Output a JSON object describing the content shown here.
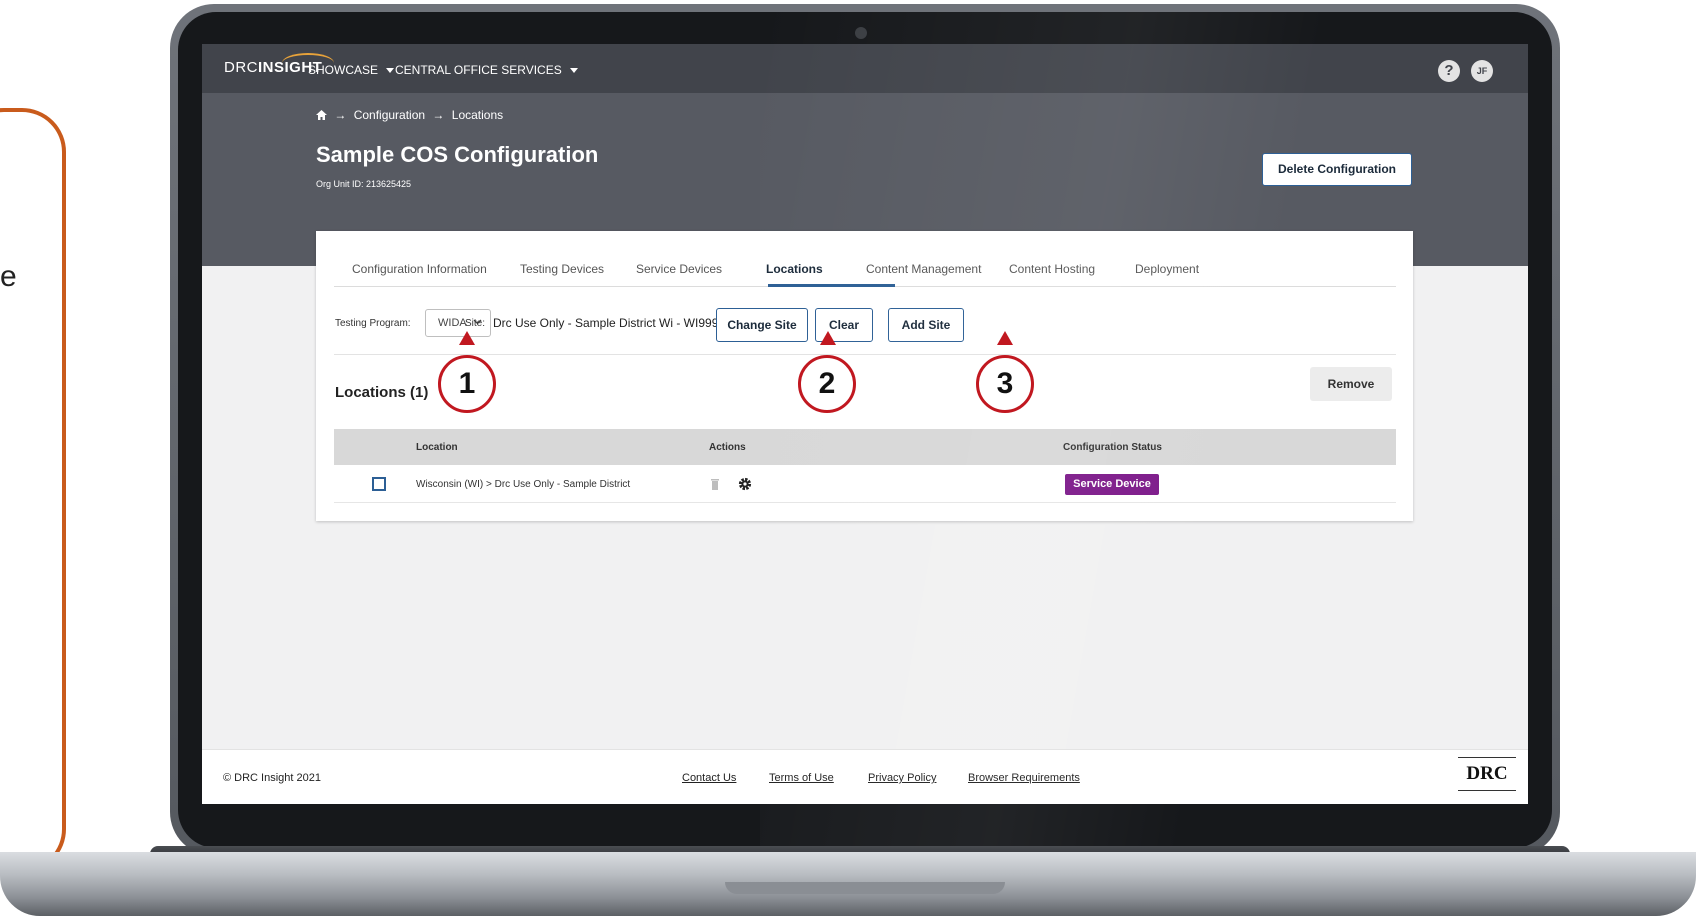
{
  "app": {
    "logo_left": "DRC",
    "logo_right": "INSIGHT",
    "nav": [
      "SHOWCASE",
      "CENTRAL OFFICE SERVICES"
    ],
    "help": "?",
    "avatar": "JF"
  },
  "breadcrumb": {
    "home_icon": "home-icon",
    "items": [
      "Configuration",
      "Locations"
    ],
    "separator": "→"
  },
  "page": {
    "title": "Sample COS Configuration",
    "org_unit": "Org Unit ID: 213625425",
    "delete_label": "Delete Configuration"
  },
  "tabs": [
    {
      "label": "Configuration Information",
      "active": false
    },
    {
      "label": "Testing Devices",
      "active": false
    },
    {
      "label": "Service Devices",
      "active": false
    },
    {
      "label": "Locations",
      "active": true
    },
    {
      "label": "Content Management",
      "active": false
    },
    {
      "label": "Content Hosting",
      "active": false
    },
    {
      "label": "Deployment",
      "active": false
    }
  ],
  "filters": {
    "program_label": "Testing Program:",
    "program_value": "WIDA",
    "site_label": "Site:",
    "site_value": "Drc Use Only - Sample District Wi - WI99999",
    "change_site": "Change Site",
    "clear": "Clear",
    "add_site": "Add Site"
  },
  "locations": {
    "title": "Locations (1)",
    "remove_label": "Remove",
    "columns": [
      "Location",
      "Actions",
      "Configuration Status"
    ],
    "rows": [
      {
        "location": "Wisconsin (WI) > Drc Use Only - Sample District",
        "status": "Service Device"
      }
    ]
  },
  "footer": {
    "copyright": "© DRC Insight 2021",
    "links": [
      "Contact Us",
      "Terms of Use",
      "Privacy Policy",
      "Browser Requirements"
    ],
    "logo": "DRC"
  },
  "callouts": [
    "1",
    "2",
    "3"
  ],
  "side_panel": {
    "visible_letter": "e"
  },
  "colors": {
    "accent": "#2c5f95",
    "badge": "#7d1a8a",
    "callout": "#c11820",
    "panel_border": "#c95b1c",
    "nav": "#41444b"
  }
}
